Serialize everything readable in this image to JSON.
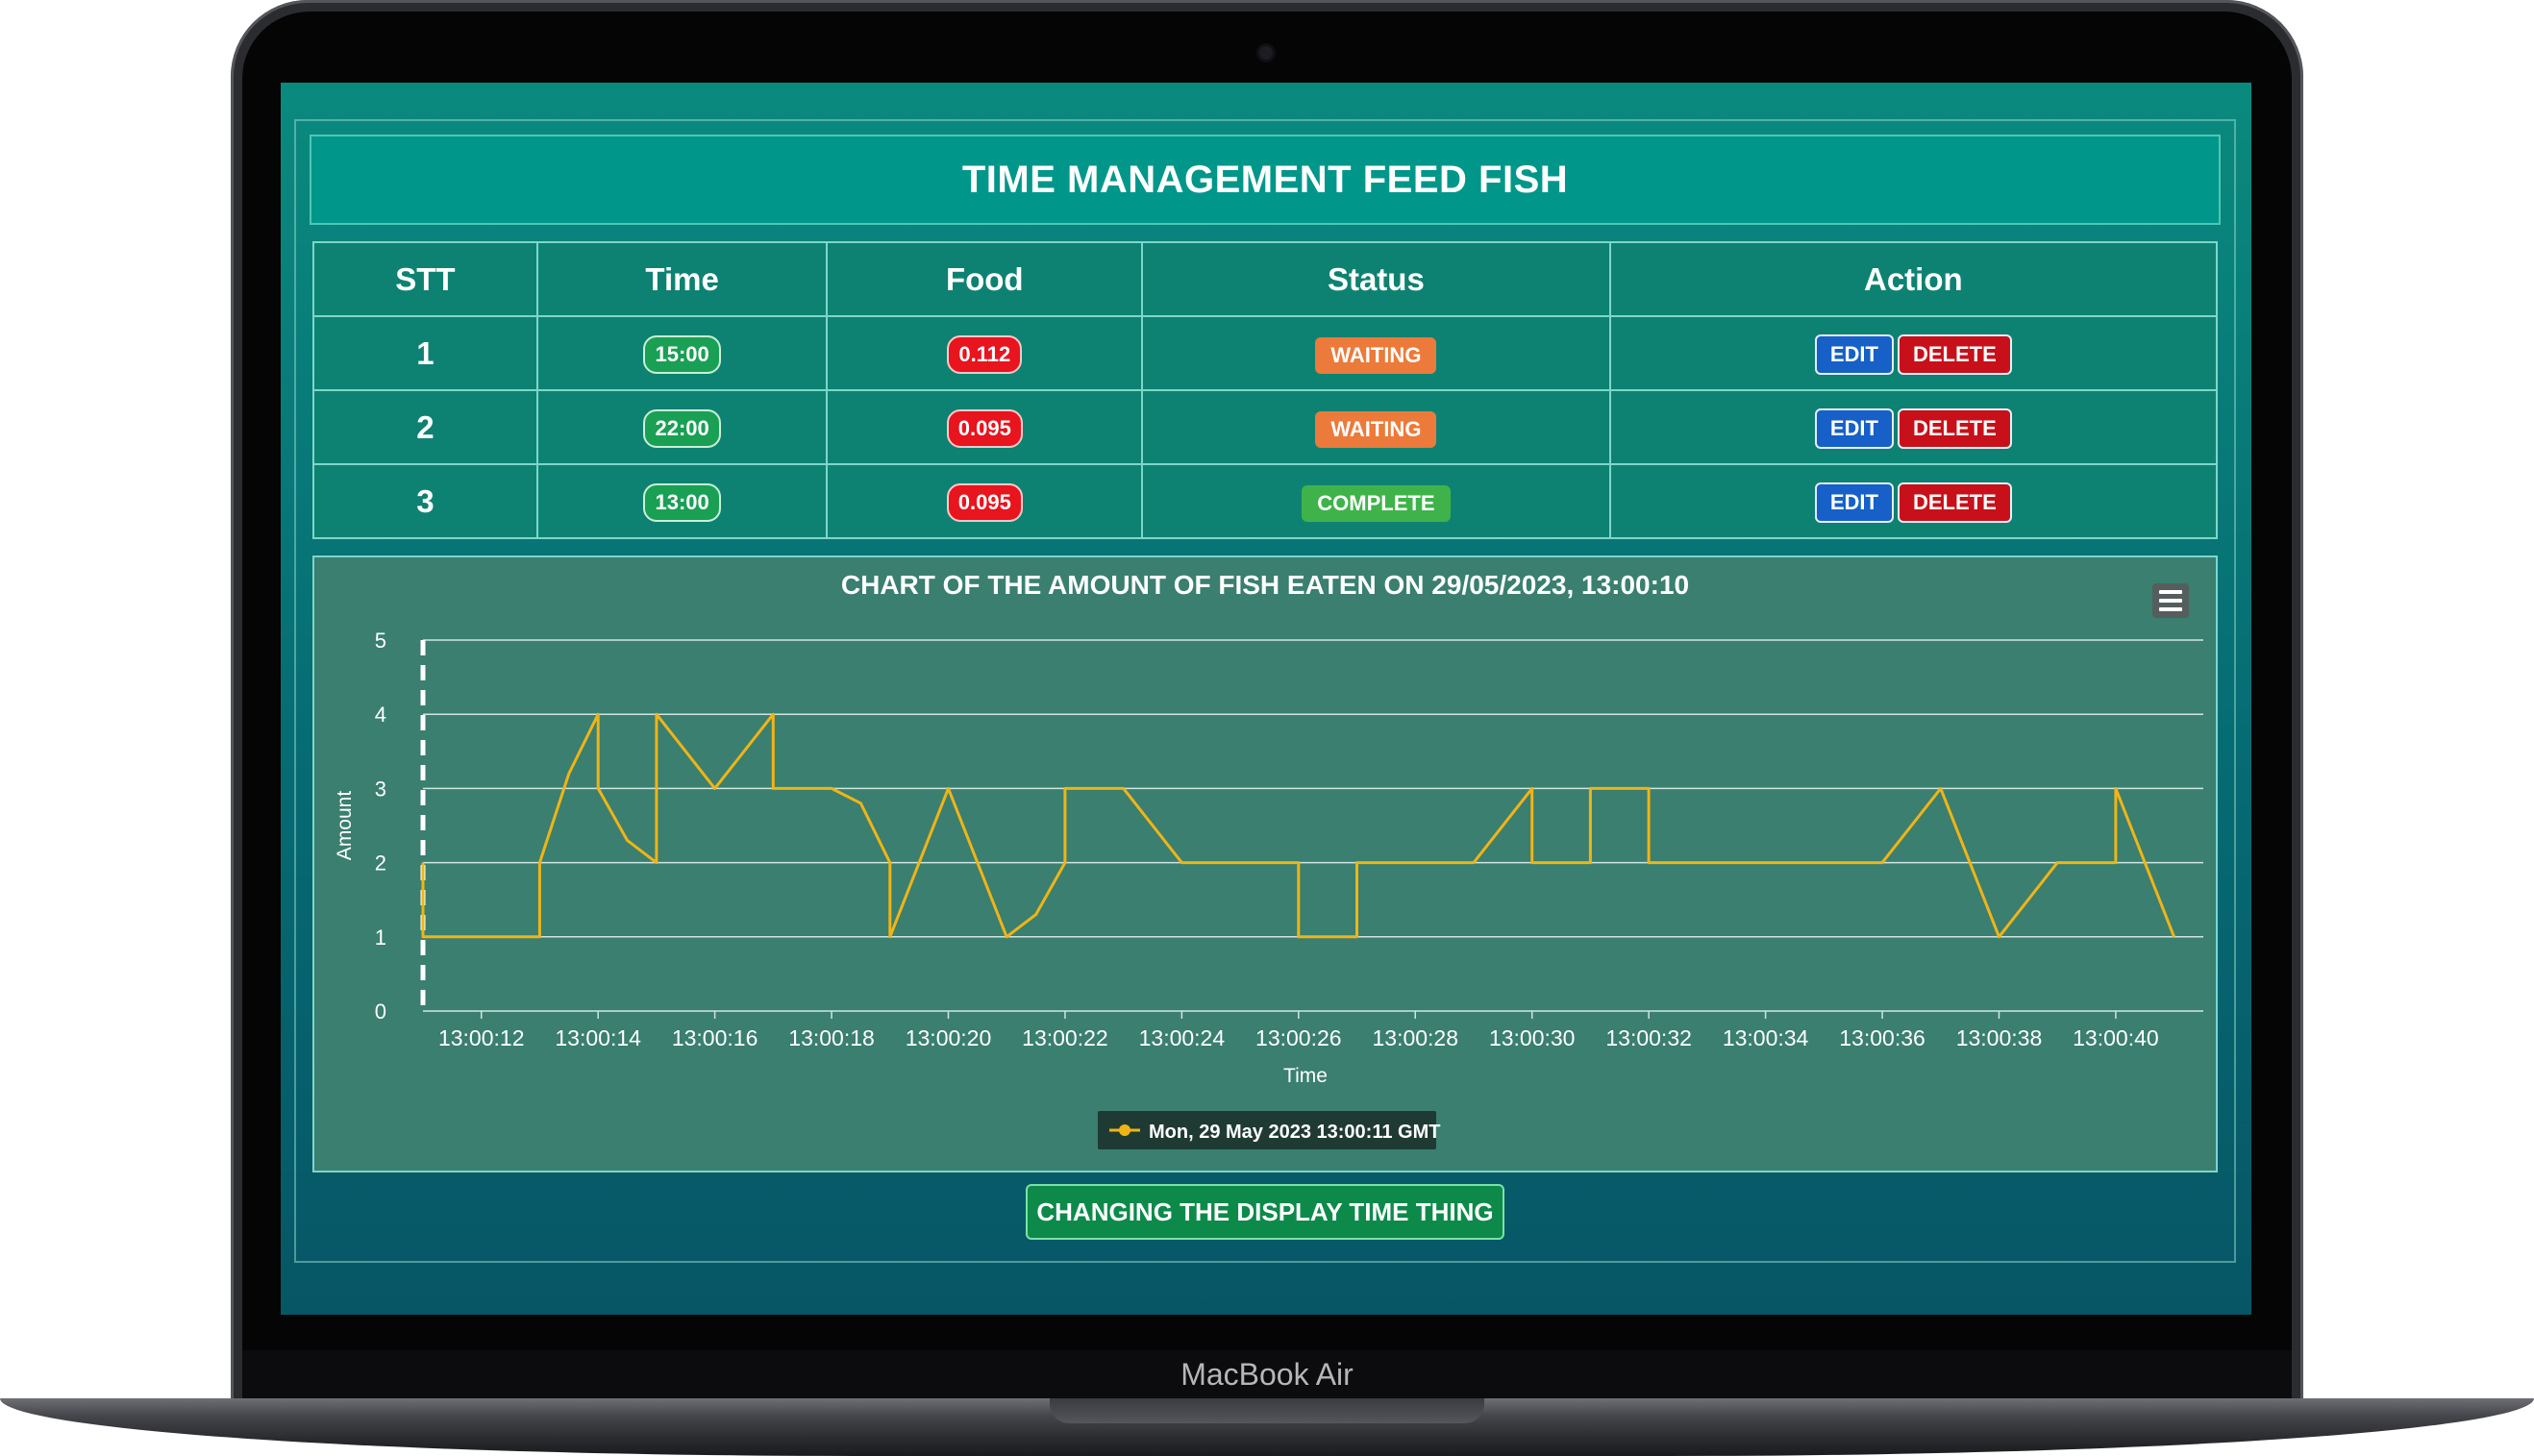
{
  "device": {
    "brand": "MacBook Air"
  },
  "page": {
    "title": "TIME MANAGEMENT FEED FISH"
  },
  "table": {
    "headers": [
      "STT",
      "Time",
      "Food",
      "Status",
      "Action"
    ],
    "rows": [
      {
        "stt": "1",
        "time": "15:00",
        "food": "0.112",
        "status": "WAITING",
        "status_type": "waiting"
      },
      {
        "stt": "2",
        "time": "22:00",
        "food": "0.095",
        "status": "WAITING",
        "status_type": "waiting"
      },
      {
        "stt": "3",
        "time": "13:00",
        "food": "0.095",
        "status": "COMPLETE",
        "status_type": "complete"
      }
    ],
    "edit_label": "EDIT",
    "delete_label": "DELETE"
  },
  "chart_menu_icon": "hamburger-menu-icon",
  "bottom_button_label": "CHANGING THE DISPLAY TIME THING",
  "chart_data": {
    "type": "line",
    "title": "CHART OF THE AMOUNT OF FISH EATEN ON 29/05/2023, 13:00:10",
    "xlabel": "Time",
    "ylabel": "Amount",
    "ylim": [
      0,
      5
    ],
    "yticks": [
      "0",
      "1",
      "2",
      "3",
      "4",
      "5"
    ],
    "xlim": [
      "13:00:11",
      "13:00:41.5"
    ],
    "xticks": [
      "13:00:12",
      "13:00:14",
      "13:00:16",
      "13:00:18",
      "13:00:20",
      "13:00:22",
      "13:00:24",
      "13:00:26",
      "13:00:28",
      "13:00:30",
      "13:00:32",
      "13:00:34",
      "13:00:36",
      "13:00:38",
      "13:00:40"
    ],
    "grid": true,
    "legend_position": "bottom-center",
    "marker_line_x": "13:00:11",
    "series": [
      {
        "name": "Mon, 29 May 2023 13:00:11 GMT",
        "color": "#f0b417",
        "points": [
          [
            "13:00:11",
            2
          ],
          [
            "13:00:11",
            1
          ],
          [
            "13:00:13",
            1
          ],
          [
            "13:00:13",
            2
          ],
          [
            "13:00:13.5",
            3.2
          ],
          [
            "13:00:14",
            4
          ],
          [
            "13:00:14",
            3
          ],
          [
            "13:00:14.5",
            2.3
          ],
          [
            "13:00:15",
            2
          ],
          [
            "13:00:15",
            4
          ],
          [
            "13:00:16",
            3
          ],
          [
            "13:00:17",
            4
          ],
          [
            "13:00:17",
            3
          ],
          [
            "13:00:18",
            3
          ],
          [
            "13:00:18.5",
            2.8
          ],
          [
            "13:00:19",
            2
          ],
          [
            "13:00:19",
            1
          ],
          [
            "13:00:20",
            3
          ],
          [
            "13:00:21",
            1
          ],
          [
            "13:00:21.5",
            1.3
          ],
          [
            "13:00:22",
            2
          ],
          [
            "13:00:22",
            3
          ],
          [
            "13:00:23",
            3
          ],
          [
            "13:00:24",
            2
          ],
          [
            "13:00:26",
            2
          ],
          [
            "13:00:26",
            1
          ],
          [
            "13:00:27",
            1
          ],
          [
            "13:00:27",
            2
          ],
          [
            "13:00:29",
            2
          ],
          [
            "13:00:30",
            3
          ],
          [
            "13:00:30",
            2
          ],
          [
            "13:00:31",
            2
          ],
          [
            "13:00:31",
            3
          ],
          [
            "13:00:32",
            3
          ],
          [
            "13:00:32",
            2
          ],
          [
            "13:00:36",
            2
          ],
          [
            "13:00:37",
            3
          ],
          [
            "13:00:38",
            1
          ],
          [
            "13:00:39",
            2
          ],
          [
            "13:00:40",
            2
          ],
          [
            "13:00:40",
            3
          ],
          [
            "13:00:41",
            1
          ]
        ]
      }
    ]
  }
}
